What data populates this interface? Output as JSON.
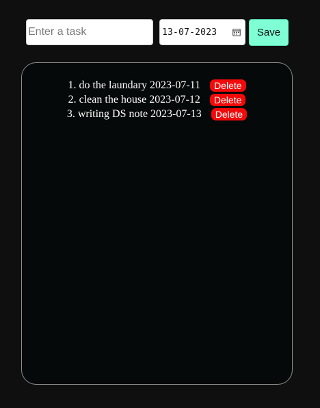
{
  "form": {
    "task_placeholder": "Enter a task",
    "task_value": "",
    "date_value": "13-07-2023",
    "save_label": "Save",
    "calendar_icon": "calendar-icon"
  },
  "todos": [
    {
      "number": "1.",
      "text": "do the laundary",
      "date": "2023-07-11",
      "delete_label": "Delete"
    },
    {
      "number": "2.",
      "text": "clean the house",
      "date": "2023-07-12",
      "delete_label": "Delete"
    },
    {
      "number": "3.",
      "text": "writing DS note",
      "date": "2023-07-13",
      "delete_label": "Delete"
    }
  ],
  "colors": {
    "page_background": "#0f0f0f",
    "panel_background": "#06090a",
    "save_button": "#7fffd4",
    "delete_button": "#f20a0a",
    "text": "#ffffff"
  }
}
